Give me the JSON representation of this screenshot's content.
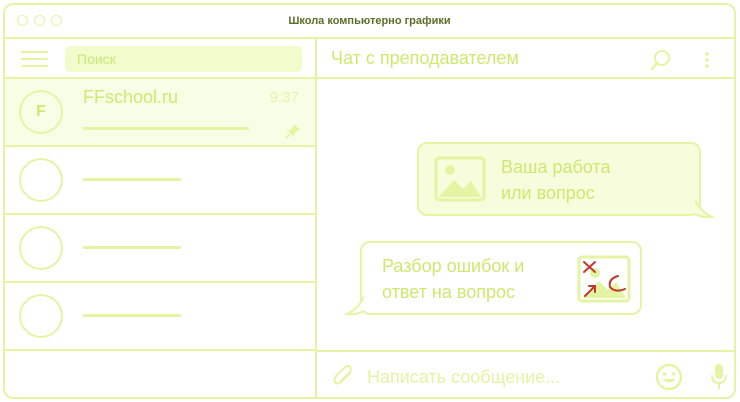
{
  "window": {
    "title": "Школа компьютерно графики"
  },
  "sidebar": {
    "search_placeholder": "Поиск",
    "chats": [
      {
        "name": "FFschool.ru",
        "time": "9:37",
        "avatar_letter": "F",
        "pinned": true
      },
      {
        "name": "",
        "time": ""
      },
      {
        "name": "",
        "time": ""
      },
      {
        "name": "",
        "time": ""
      }
    ]
  },
  "chat": {
    "title": "Чат с преподавателем",
    "messages": [
      {
        "direction": "outgoing",
        "text_line1": "Ваша работа",
        "text_line2": "или вопрос",
        "attachment": "image-placeholder-icon"
      },
      {
        "direction": "incoming",
        "text_line1": "Разбор ошибок и",
        "text_line2": "ответ на вопрос",
        "attachment": "annotated-image-icon"
      }
    ],
    "composer_placeholder": "Написать сообщение..."
  },
  "icons": {
    "menu": "hamburger-icon",
    "search": "search-icon",
    "more": "more-vertical-icon",
    "pin": "pin-icon",
    "attach": "paperclip-icon",
    "emoji": "emoji-icon",
    "mic": "microphone-icon"
  },
  "colors": {
    "border": "#e3f5a3",
    "accent": "#cde96f",
    "title_text": "#5b6e29",
    "annotation_red": "#c0392b"
  }
}
